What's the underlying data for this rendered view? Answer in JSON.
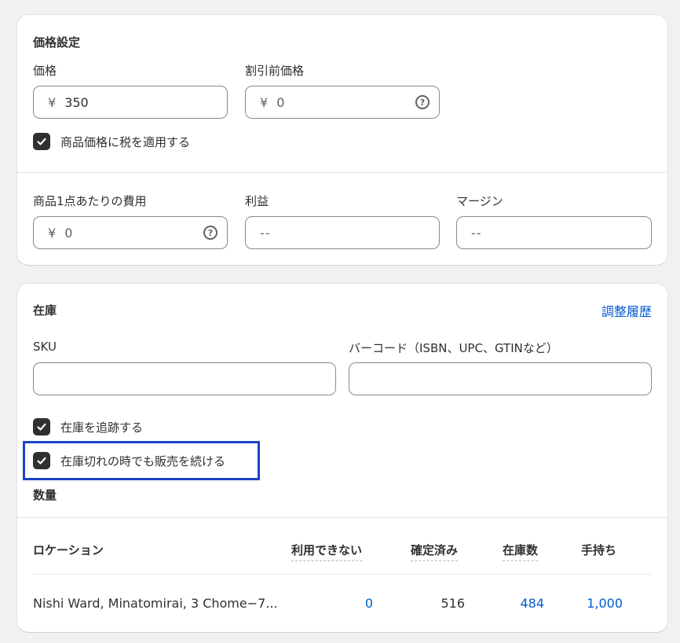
{
  "pricing": {
    "heading": "価格設定",
    "price_label": "価格",
    "price_prefix": "¥",
    "price_value": "350",
    "compare_label": "割引前価格",
    "compare_prefix": "¥",
    "compare_value": "0",
    "tax_checkbox_label": "商品価格に税を適用する",
    "tax_checked": true,
    "cost_label": "商品1点あたりの費用",
    "cost_prefix": "¥",
    "cost_value": "0",
    "profit_label": "利益",
    "profit_value": "--",
    "margin_label": "マージン",
    "margin_value": "--"
  },
  "inventory": {
    "heading": "在庫",
    "history_link": "調整履歴",
    "sku_label": "SKU",
    "sku_value": "",
    "barcode_label": "バーコード（ISBN、UPC、GTINなど）",
    "barcode_value": "",
    "track_label": "在庫を追跡する",
    "track_checked": true,
    "continue_label": "在庫切れの時でも販売を続ける",
    "continue_checked": true,
    "quantity_heading": "数量",
    "table": {
      "headers": {
        "location": "ロケーション",
        "unavailable": "利用できない",
        "committed": "確定済み",
        "available": "在庫数",
        "on_hand": "手持ち"
      },
      "rows": [
        {
          "location": "Nishi Ward, Minatomirai, 3 Chome−7...",
          "unavailable": "0",
          "committed": "516",
          "available": "484",
          "on_hand": "1,000"
        }
      ]
    }
  },
  "colors": {
    "link": "#005bd3",
    "highlight_border": "#1a44c8",
    "checkbox_fill": "#303030"
  }
}
